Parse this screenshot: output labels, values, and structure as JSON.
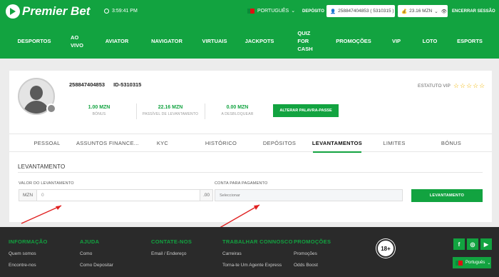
{
  "header": {
    "logo_text": "Premier Bet",
    "time": "3:59:41 PM",
    "language": "PORTUGUÊS",
    "deposit_label": "DEPÓSITO",
    "account_select": "258847404853 ( 5310315 )",
    "balance": "23.16 MZN",
    "logout_label": "ENCERRAR SESSÃO"
  },
  "nav": {
    "items": [
      {
        "label": "DESPORTOS"
      },
      {
        "label": "AO\nVIVO"
      },
      {
        "label": "AVIATOR"
      },
      {
        "label": "NAVIGATOR"
      },
      {
        "label": "VIRTUAIS"
      },
      {
        "label": "JACKPOTS"
      },
      {
        "label": "QUIZ\nFOR\nCASH"
      },
      {
        "label": "PROMOÇÕES"
      },
      {
        "label": "VIP"
      },
      {
        "label": "LOTO"
      },
      {
        "label": "ESPORTS"
      }
    ]
  },
  "profile": {
    "phone": "258847404853",
    "id": "ID-5310315",
    "vip_label": "ESTATUTO VIP",
    "vip_stars": "☆☆☆☆☆",
    "stats": [
      {
        "value": "1.00 MZN",
        "label": "BÓNUS"
      },
      {
        "value": "22.16 MZN",
        "label": "PASSÍVEL DE LEVANTAMENTO"
      },
      {
        "value": "0.00 MZN",
        "label": "A DESBLOQUEAR"
      }
    ],
    "change_password_label": "ALTERAR PALAVRA-PASSE"
  },
  "tabs": [
    {
      "label": "PESSOAL"
    },
    {
      "label": "ASSUNTOS FINANCE..."
    },
    {
      "label": "KYC"
    },
    {
      "label": "HISTÓRICO"
    },
    {
      "label": "DEPÓSITOS"
    },
    {
      "label": "LEVANTAMENTOS"
    },
    {
      "label": "LIMITES"
    },
    {
      "label": "BÓNUS"
    }
  ],
  "withdraw": {
    "section_title": "LEVANTAMENTO",
    "amount_label": "VALOR DO LEVANTAMENTO",
    "currency": "MZN",
    "amount_value": "0",
    "decimals": ".00",
    "account_label": "CONTA PARA PAGAMENTO",
    "account_placeholder": "Seleccionar",
    "button_label": "LEVANTAMENTO"
  },
  "footer": {
    "columns": [
      {
        "heading": "INFORMAÇÃO",
        "links": [
          "Quem somos",
          "Encontre-nos"
        ]
      },
      {
        "heading": "AJUDA",
        "links": [
          "Como",
          "Como Depositar"
        ]
      },
      {
        "heading": "CONTATE-NOS",
        "links": [
          "Email / Endereço"
        ]
      },
      {
        "heading": "TRABALHAR CONNOSCO",
        "links": [
          "Carreiras",
          "Torna-te Um Agente Express"
        ]
      },
      {
        "heading": "PROMOÇÕES",
        "links": [
          "Promoções",
          "Odds Boost"
        ]
      }
    ],
    "age_badge": "18+",
    "social": [
      "f",
      "◎",
      "▶"
    ],
    "language": "Português"
  },
  "colors": {
    "brand_green": "#12a340",
    "footer_bg": "#2a2a2a",
    "annotation_red": "#e02020"
  }
}
